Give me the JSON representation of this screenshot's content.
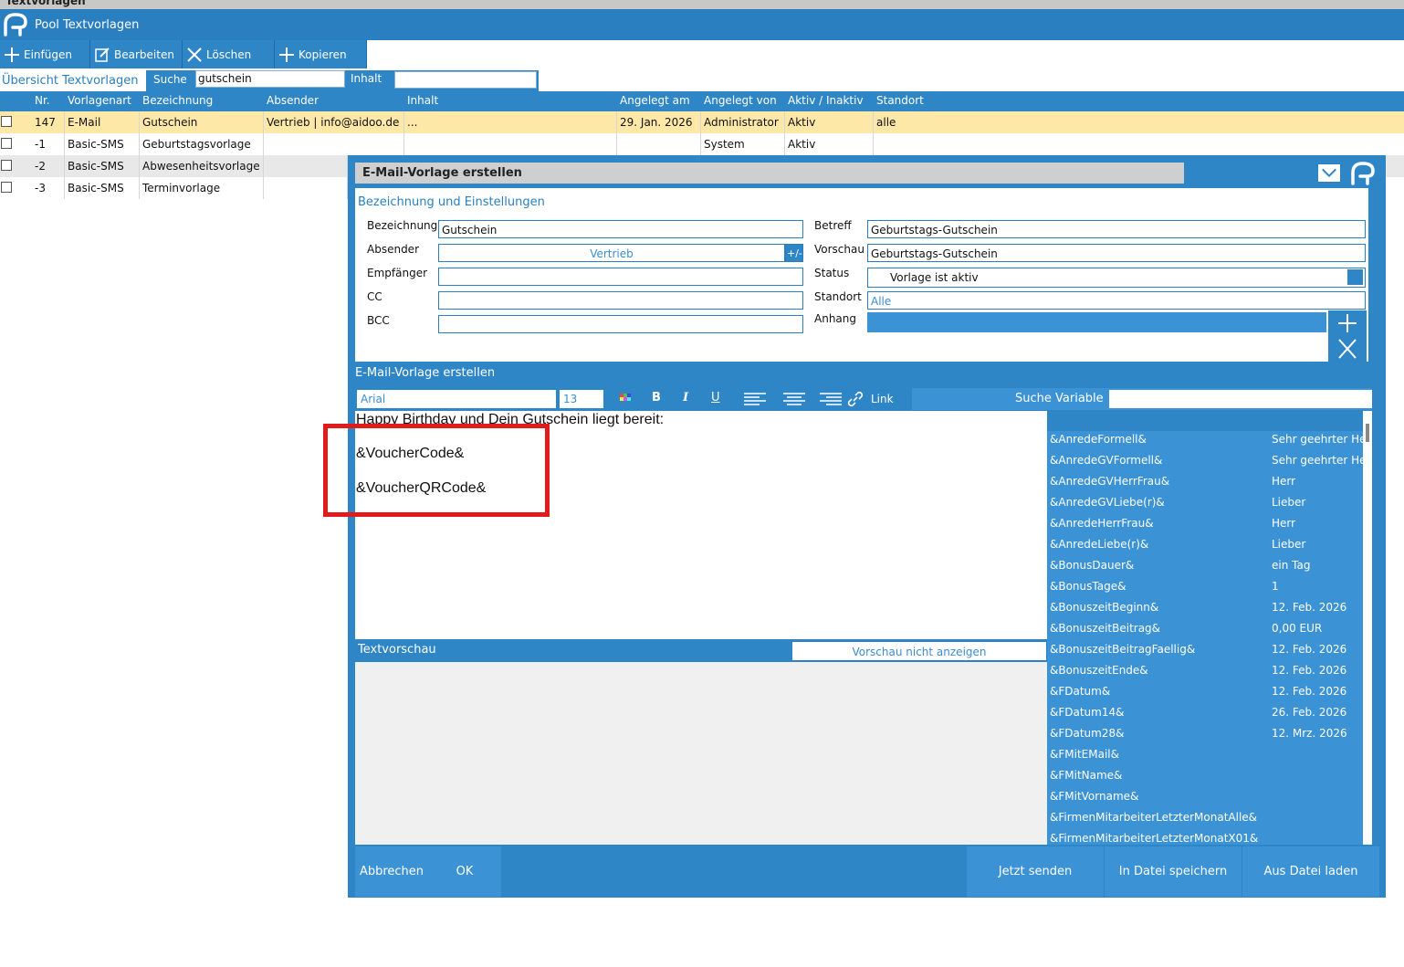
{
  "window": {
    "title": "Textvorlagen"
  },
  "app": {
    "title": "Pool Textvorlagen"
  },
  "toolbar": {
    "insert": "Einfügen",
    "edit": "Bearbeiten",
    "delete": "Löschen",
    "copy": "Kopieren"
  },
  "filter": {
    "overview": "Übersicht Textvorlagen",
    "search_label": "Suche",
    "search_value": "gutschein",
    "content_label": "Inhalt",
    "content_value": ""
  },
  "table": {
    "headers": [
      "Nr.",
      "Vorlagenart",
      "Bezeichnung",
      "Absender",
      "Inhalt",
      "Angelegt am",
      "Angelegt von",
      "Aktiv / Inaktiv",
      "Standort"
    ],
    "rows": [
      [
        "147",
        "E-Mail",
        "Gutschein",
        "Vertrieb | info@aidoo.de",
        "...",
        "29. Jan. 2026",
        "Administrator",
        "Aktiv",
        "alle"
      ],
      [
        "-1",
        "Basic-SMS",
        "Geburtstagsvorlage",
        "",
        "",
        "",
        "System",
        "Aktiv",
        ""
      ],
      [
        "-2",
        "Basic-SMS",
        "Abwesenheitsvorlage",
        "",
        "",
        "",
        "",
        "",
        ""
      ],
      [
        "-3",
        "Basic-SMS",
        "Terminvorlage",
        "",
        "",
        "",
        "",
        "",
        ""
      ]
    ]
  },
  "dialog": {
    "title": "E-Mail-Vorlage erstellen",
    "section": "Bezeichnung und Einstellungen",
    "labels": {
      "name": "Bezeichnung",
      "sender": "Absender",
      "recipient": "Empfänger",
      "cc": "CC",
      "bcc": "BCC",
      "subject": "Betreff",
      "preview": "Vorschau",
      "status": "Status",
      "location": "Standort",
      "attachment": "Anhang"
    },
    "values": {
      "name": "Gutschein",
      "sender": "Vertrieb",
      "sender_btn": "+/-",
      "recipient": "",
      "cc": "",
      "bcc": "",
      "subject": "Geburtstags-Gutschein",
      "preview": "Geburtstags-Gutschein",
      "status": "Vorlage ist aktiv",
      "location": "Alle"
    },
    "editor_header": "E-Mail-Vorlage erstellen",
    "font": "Arial",
    "size": "13",
    "bold": "B",
    "italic": "I",
    "underline": "U",
    "link": "Link",
    "search_variable": "Suche Variable",
    "editor_lines": [
      "Happy Birthday und Dein Gutschein liegt bereit:",
      "&VoucherCode&",
      "&VoucherQRCode&"
    ],
    "variables": [
      [
        "&AnredeFormell&",
        "Sehr geehrter He"
      ],
      [
        "&AnredeGVFormell&",
        "Sehr geehrter He"
      ],
      [
        "&AnredeGVHerrFrau&",
        "Herr"
      ],
      [
        "&AnredeGVLiebe(r)&",
        "Lieber"
      ],
      [
        "&AnredeHerrFrau&",
        "Herr"
      ],
      [
        "&AnredeLiebe(r)&",
        "Lieber"
      ],
      [
        "&BonusDauer&",
        "ein Tag"
      ],
      [
        "&BonusTage&",
        "1"
      ],
      [
        "&BonuszeitBeginn&",
        "12. Feb. 2026"
      ],
      [
        "&BonuszeitBeitrag&",
        "0,00 EUR"
      ],
      [
        "&BonuszeitBeitragFaellig&",
        "12. Feb. 2026"
      ],
      [
        "&BonuszeitEnde&",
        "12. Feb. 2026"
      ],
      [
        "&FDatum&",
        "12. Feb. 2026"
      ],
      [
        "&FDatum14&",
        "26. Feb. 2026"
      ],
      [
        "&FDatum28&",
        "12. Mrz. 2026"
      ],
      [
        "&FMitEMail&",
        ""
      ],
      [
        "&FMitName&",
        ""
      ],
      [
        "&FMitVorname&",
        ""
      ],
      [
        "&FirmenMitarbeiterLetzterMonatAlle&",
        ""
      ],
      [
        "&FirmenMitarbeiterLetzterMonatX01&",
        ""
      ]
    ],
    "preview_header": "Textvorschau",
    "preview_toggle": "Vorschau nicht anzeigen",
    "buttons": {
      "cancel": "Abbrechen",
      "ok": "OK",
      "send": "Jetzt senden",
      "save_file": "In Datei speichern",
      "load_file": "Aus Datei laden"
    }
  },
  "colors": {
    "primary": "#2f86c6",
    "highlight_row": "#fde8a8",
    "annotation": "#e01b1b"
  }
}
